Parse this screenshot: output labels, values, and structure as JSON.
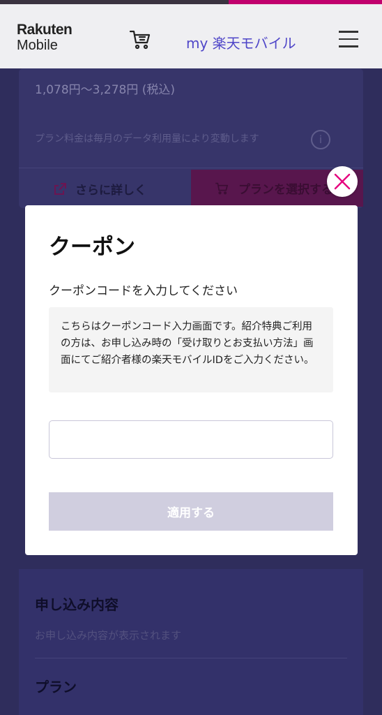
{
  "header": {
    "logo_line1": "Rakuten",
    "logo_line2": "Mobile",
    "cart_icon": "cart-icon",
    "my_link": "my 楽天モバイル",
    "menu_icon": "hamburger-menu-icon"
  },
  "background_page": {
    "price": "1,078円〜3,278円 (税込)",
    "plan_note": "プラン料金は毎月のデータ利用量により変動します",
    "more_label": "さらに詳しく",
    "select_plan_label": "プランを選択する",
    "apply_section_title": "申し込み内容",
    "apply_section_sub": "お申し込み内容が表示されます",
    "plan_section_title": "プラン"
  },
  "modal": {
    "title": "クーポン",
    "label": "クーポンコードを入力してください",
    "info_text": "こちらはクーポンコード入力画面です。紹介特典ご利用の方は、お申し込み時の「受け取りとお支払い方法」画面にてご紹介者様の楽天モバイルIDをご入力ください。",
    "input_value": "",
    "apply_label": "適用する",
    "close_icon": "close-icon"
  },
  "colors": {
    "accent": "#4f46c8",
    "close_x": "#e6007e",
    "overlay": "#2f2d5c",
    "apply_disabled": "#d0cedf"
  }
}
